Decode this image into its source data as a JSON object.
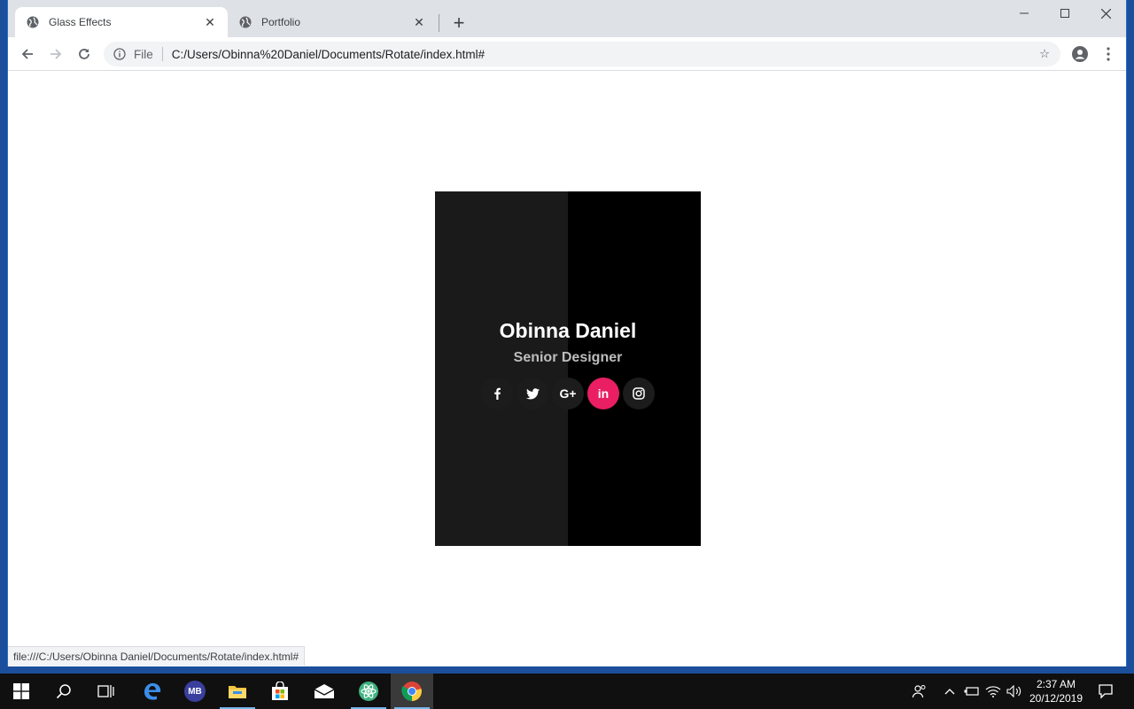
{
  "browser": {
    "tabs": [
      {
        "title": "Glass Effects",
        "active": true
      },
      {
        "title": "Portfolio",
        "active": false
      }
    ],
    "url_scheme_label": "File",
    "url": "C:/Users/Obinna%20Daniel/Documents/Rotate/index.html#",
    "status_url": "file:///C:/Users/Obinna Daniel/Documents/Rotate/index.html#"
  },
  "card": {
    "name": "Obinna Daniel",
    "role": "Senior Designer",
    "social": [
      {
        "icon": "facebook-icon",
        "glyph": "f",
        "highlighted": false
      },
      {
        "icon": "twitter-icon",
        "glyph": "🐦",
        "highlighted": false
      },
      {
        "icon": "google-plus-icon",
        "glyph": "G+",
        "highlighted": false
      },
      {
        "icon": "linkedin-icon",
        "glyph": "in",
        "highlighted": true
      },
      {
        "icon": "instagram-icon",
        "glyph": "◎",
        "highlighted": false
      }
    ],
    "colors": {
      "background": "#000000",
      "glass": "#1a1a1a",
      "highlight": "#e91e63"
    }
  },
  "taskbar": {
    "clock_time": "2:37 AM",
    "clock_date": "20/12/2019",
    "apps": [
      "start-icon",
      "search-icon",
      "task-view-icon",
      "edge-icon",
      "mb-app-icon",
      "file-explorer-icon",
      "store-icon",
      "mail-icon",
      "atom-icon",
      "chrome-icon"
    ],
    "mb_label": "MB"
  }
}
